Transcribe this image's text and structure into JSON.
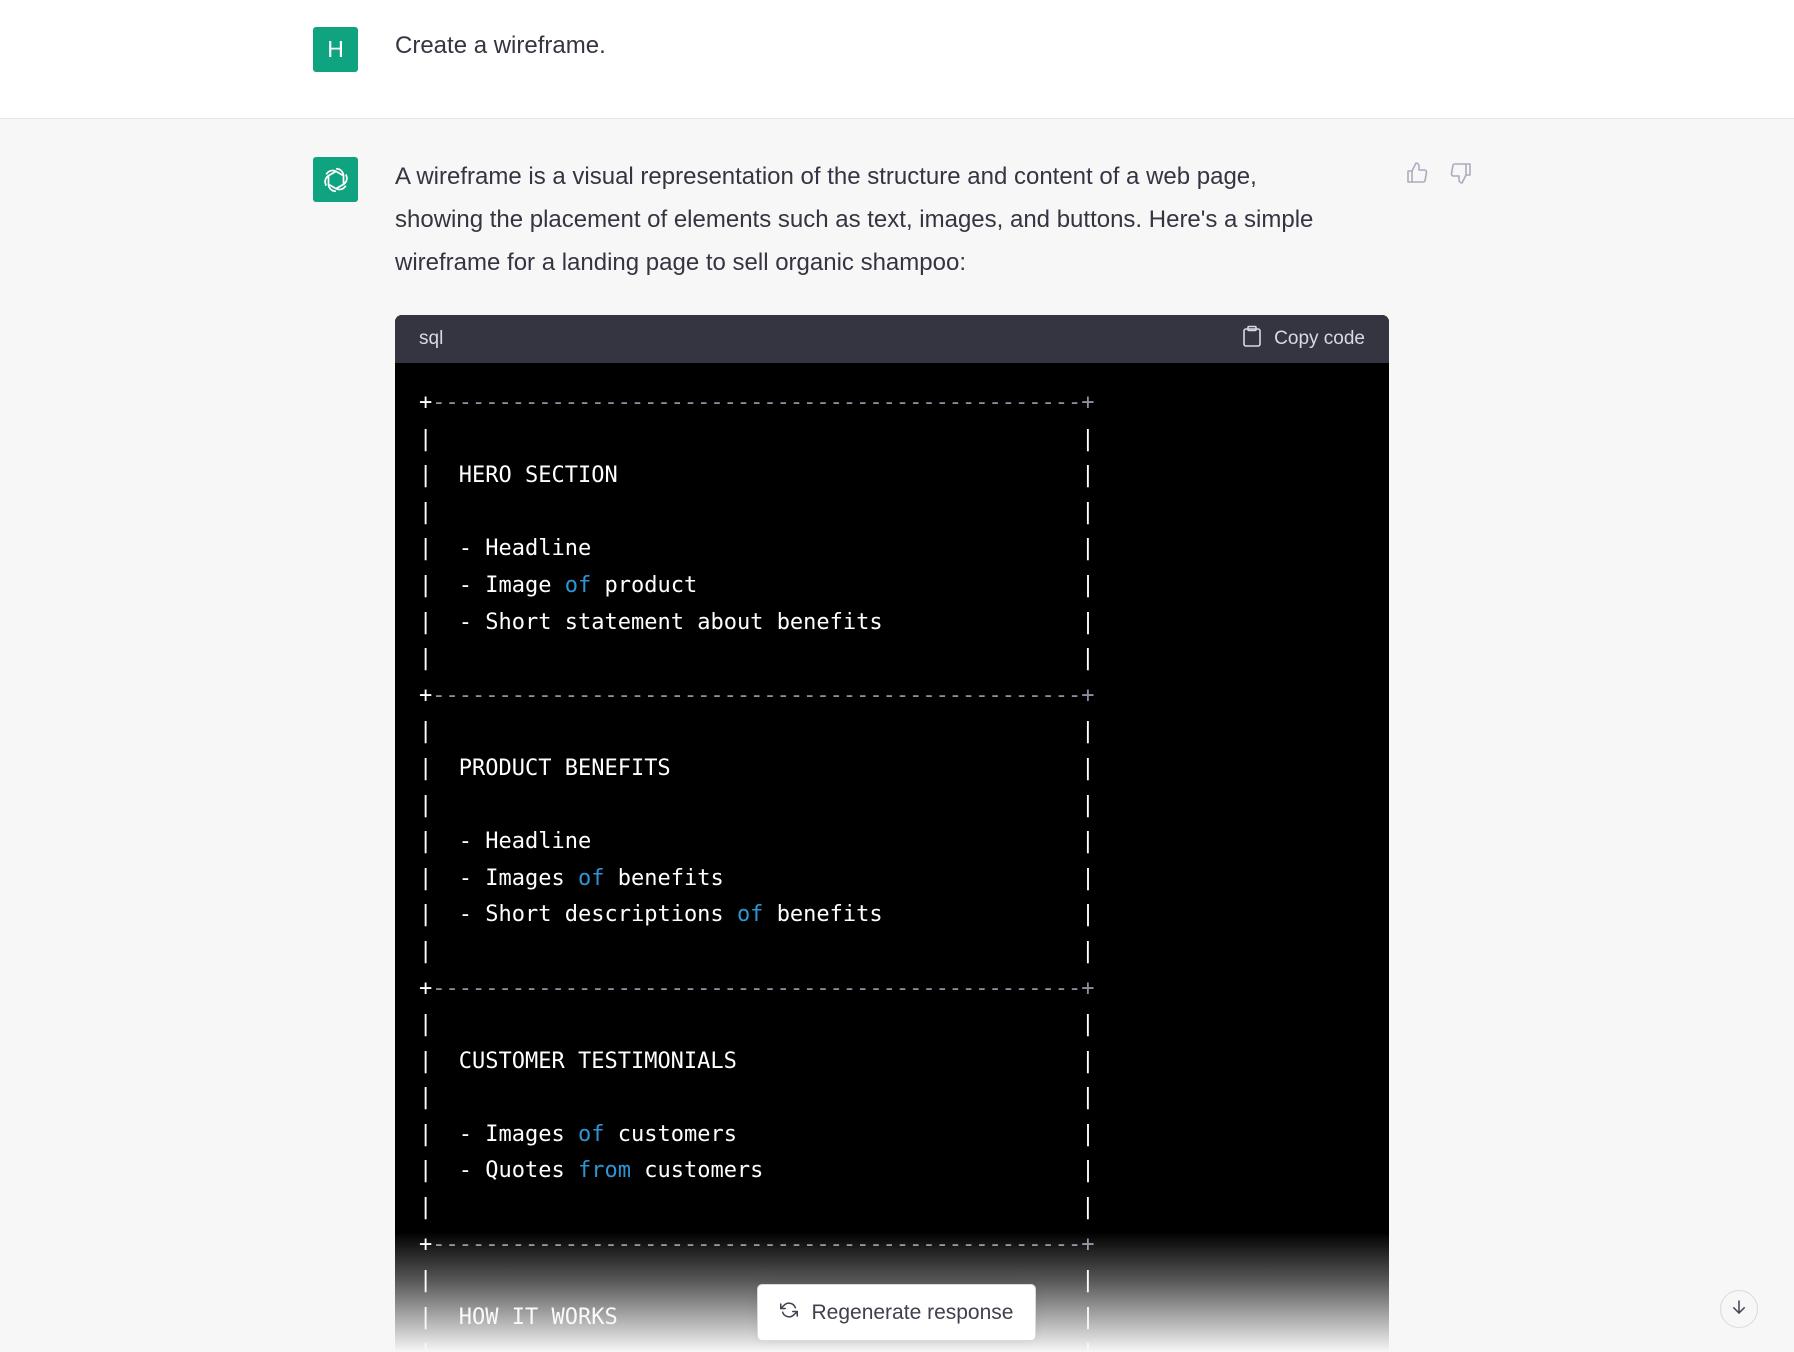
{
  "user_message": {
    "avatar_initial": "H",
    "text": "Create a wireframe."
  },
  "assistant_message": {
    "avatar_icon": "openai-logo-icon",
    "intro_lines": [
      "A wireframe is a visual representation of the structure and content of a web page,",
      "showing the placement of elements such as text, images, and buttons. Here's a simple",
      "wireframe for a landing page to sell organic shampoo:"
    ],
    "feedback": {
      "like_icon": "thumbs-up-icon",
      "dislike_icon": "thumbs-down-icon"
    }
  },
  "code_block": {
    "language": "sql",
    "copy_label": "Copy code",
    "lines": [
      "+-------------------------------------------------+",
      "|                                                 |",
      "|  HERO SECTION                                   |",
      "|                                                 |",
      "|  - Headline                                     |",
      "|  - Image of product                             |",
      "|  - Short statement about benefits               |",
      "|                                                 |",
      "+-------------------------------------------------+",
      "|                                                 |",
      "|  PRODUCT BENEFITS                               |",
      "|                                                 |",
      "|  - Headline                                     |",
      "|  - Images of benefits                           |",
      "|  - Short descriptions of benefits               |",
      "|                                                 |",
      "+-------------------------------------------------+",
      "|                                                 |",
      "|  CUSTOMER TESTIMONIALS                          |",
      "|                                                 |",
      "|  - Images of customers                          |",
      "|  - Quotes from customers                        |",
      "|                                                 |",
      "+-------------------------------------------------+",
      "|                                                 |",
      "|  HOW IT WORKS                                   |",
      "|                                                 |"
    ],
    "keywords": [
      "of",
      "from"
    ]
  },
  "regenerate": {
    "label": "Regenerate response",
    "icon": "refresh-icon"
  },
  "scroll_down_icon": "arrow-down-icon",
  "colors": {
    "accent": "#10a37f",
    "keyword": "#2e95d3",
    "code_header_bg": "#343541",
    "assistant_bg": "#f7f7f8"
  }
}
